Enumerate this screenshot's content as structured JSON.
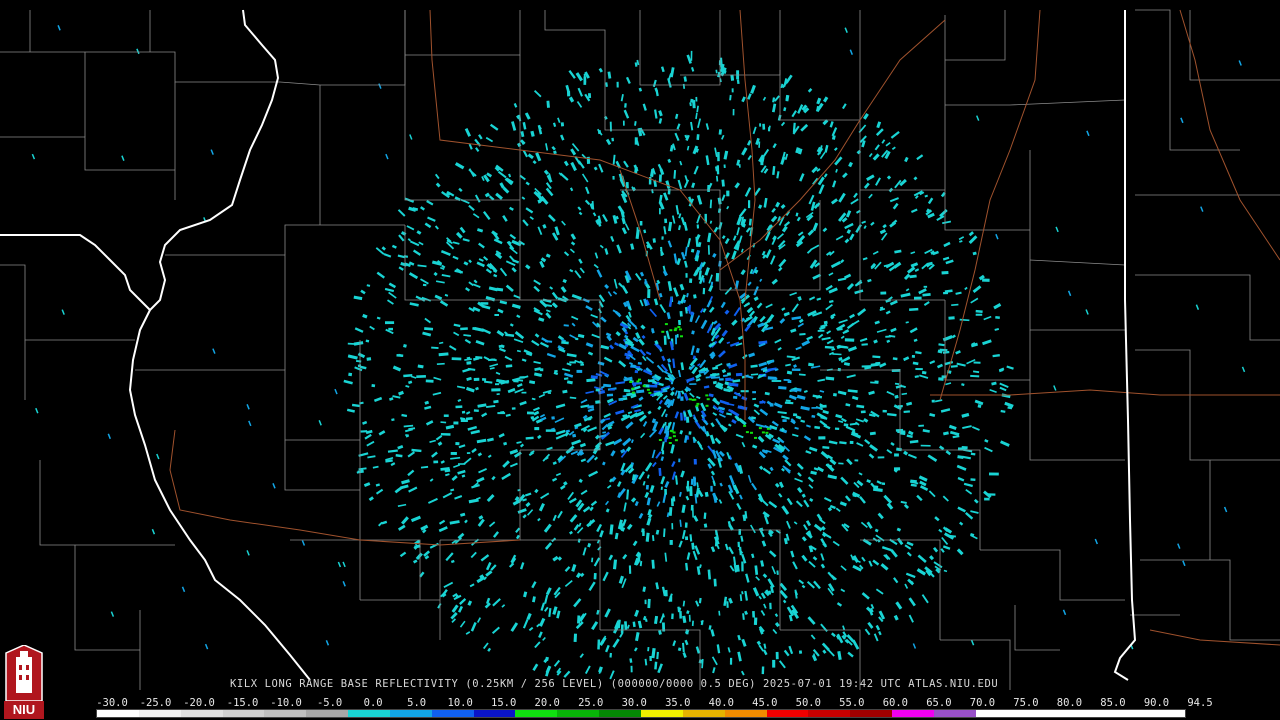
{
  "caption": "KILX LONG RANGE BASE REFLECTIVITY (0.25KM / 256 LEVEL) (000000/0000 0.5 DEG) 2025-07-01 19:42 UTC  ATLAS.NIU.EDU",
  "logo": {
    "text": "NIU",
    "color": "#b0161e",
    "icon": "university-tower-logo"
  },
  "legend": {
    "ticks": [
      "-30.0",
      "-25.0",
      "-20.0",
      "-15.0",
      "-10.0",
      "-5.0",
      "0.0",
      "5.0",
      "10.0",
      "15.0",
      "20.0",
      "25.0",
      "30.0",
      "35.0",
      "40.0",
      "45.0",
      "50.0",
      "55.0",
      "60.0",
      "65.0",
      "70.0",
      "75.0",
      "80.0",
      "85.0",
      "90.0",
      "94.5"
    ],
    "colors": [
      "#ffffff",
      "#f0f0f0",
      "#e0e0e0",
      "#d0d0d0",
      "#c0c0c0",
      "#a8a8a8",
      "#19d4d4",
      "#12a6e6",
      "#1060f0",
      "#0a14c8",
      "#10e010",
      "#08b408",
      "#048804",
      "#f0f000",
      "#e6b400",
      "#f08c00",
      "#f00000",
      "#c80000",
      "#a00000",
      "#f000f0",
      "#9850c8",
      "#ffffff",
      "#ffffff",
      "#ffffff",
      "#ffffff",
      "#ffffff"
    ]
  },
  "map_colors": {
    "background": "#000000",
    "county_lines": "#8c8c8c",
    "state_lines": "#ffffff",
    "highways": "#a0522d",
    "echo_primary": "#19d4d4",
    "echo_secondary": "#12a6e6",
    "echo_strong": "#1060f0",
    "echo_green": "#10e010"
  }
}
